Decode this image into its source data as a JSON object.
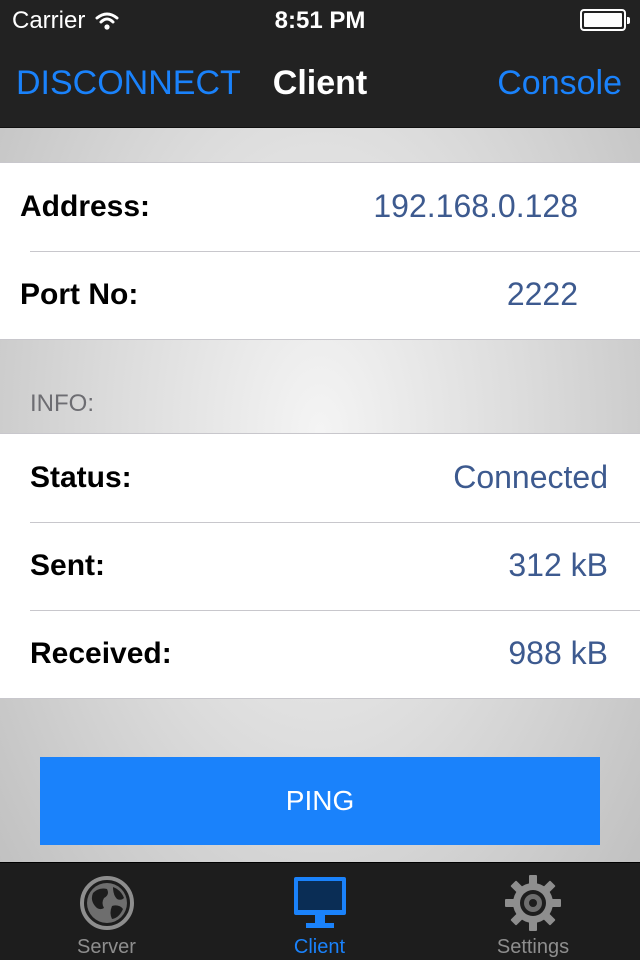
{
  "status_bar": {
    "carrier": "Carrier",
    "time": "8:51 PM"
  },
  "nav": {
    "left_button": "DISCONNECT",
    "title": "Client",
    "right_button": "Console"
  },
  "connection": {
    "rows": [
      {
        "label": "Address:",
        "value": "192.168.0.128"
      },
      {
        "label": "Port No:",
        "value": "2222"
      }
    ]
  },
  "info": {
    "header": "INFO:",
    "rows": [
      {
        "label": "Status:",
        "value": "Connected"
      },
      {
        "label": "Sent:",
        "value": "312 kB"
      },
      {
        "label": "Received:",
        "value": "988 kB"
      }
    ]
  },
  "ping_button": "PING",
  "tabs": [
    {
      "label": "Server",
      "icon": "globe-icon",
      "active": false
    },
    {
      "label": "Client",
      "icon": "monitor-icon",
      "active": true
    },
    {
      "label": "Settings",
      "icon": "gear-icon",
      "active": false
    }
  ],
  "colors": {
    "accent": "#1a82fb",
    "value_text": "#3d5a8f",
    "bar_background": "#222222"
  }
}
